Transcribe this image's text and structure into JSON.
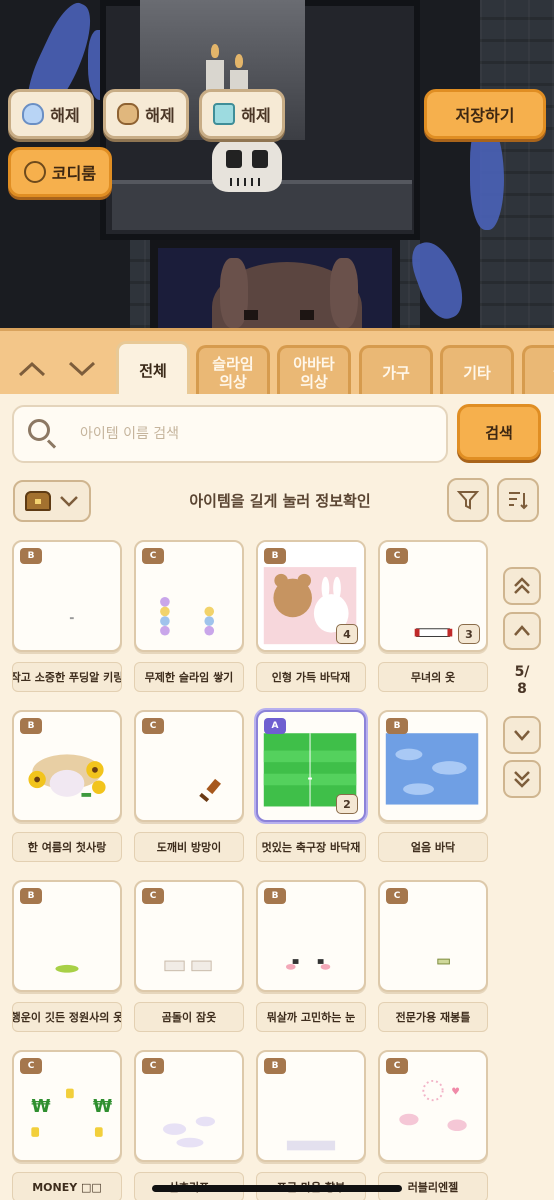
{
  "hud": {
    "release_slime_label": "해제",
    "release_avatar_label": "해제",
    "release_furniture_label": "해제",
    "save_label": "저장하기",
    "codiroom_label": "코디룸"
  },
  "tabs": [
    "전체",
    "슬라임\n의상",
    "아바타\n의상",
    "가구",
    "기타"
  ],
  "search": {
    "placeholder": "아이템 이름 검색",
    "button_label": "검색"
  },
  "hint": "아이템을 길게 눌러 정보확인",
  "pager": {
    "current": "5/",
    "total": "8"
  },
  "items": [
    {
      "grade": "B",
      "name": "작고 소중한 푸딩알 키링",
      "count": ""
    },
    {
      "grade": "C",
      "name": "무제한 슬라임 쌓기",
      "count": ""
    },
    {
      "grade": "B",
      "name": "인형 가득 바닥재",
      "count": "4"
    },
    {
      "grade": "C",
      "name": "무녀의 옷",
      "count": "3"
    },
    {
      "grade": "B",
      "name": "한 여름의 첫사랑",
      "count": ""
    },
    {
      "grade": "C",
      "name": "도깨비 방망이",
      "count": ""
    },
    {
      "grade": "A",
      "name": "멋있는 축구장 바닥재",
      "count": "2"
    },
    {
      "grade": "B",
      "name": "얼음 바닥",
      "count": ""
    },
    {
      "grade": "B",
      "name": "행운이 깃든 정원사의 옷",
      "count": ""
    },
    {
      "grade": "C",
      "name": "곰돌이 잠옷",
      "count": ""
    },
    {
      "grade": "B",
      "name": "뭐살까 고민하는 눈",
      "count": ""
    },
    {
      "grade": "C",
      "name": "전문가용 재봉틀",
      "count": ""
    },
    {
      "grade": "C",
      "name": "MONEY □□",
      "count": ""
    },
    {
      "grade": "C",
      "name": "산호리프",
      "count": ""
    },
    {
      "grade": "B",
      "name": "포근 마음 향부",
      "count": ""
    },
    {
      "grade": "C",
      "name": "러블리엔젤",
      "count": ""
    }
  ],
  "colors": {
    "accent_orange": "#f6b04d",
    "panel_bg": "#fbf1df",
    "tab_bar": "#f3c689",
    "selected_border": "#8c82d8"
  }
}
